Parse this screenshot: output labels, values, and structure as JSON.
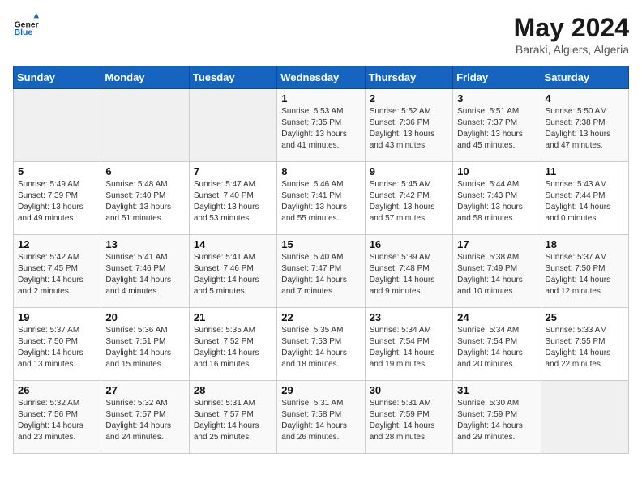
{
  "header": {
    "logo_general": "General",
    "logo_blue": "Blue",
    "title": "May 2024",
    "subtitle": "Baraki, Algiers, Algeria"
  },
  "weekdays": [
    "Sunday",
    "Monday",
    "Tuesday",
    "Wednesday",
    "Thursday",
    "Friday",
    "Saturday"
  ],
  "weeks": [
    [
      {
        "day": "",
        "info": ""
      },
      {
        "day": "",
        "info": ""
      },
      {
        "day": "",
        "info": ""
      },
      {
        "day": "1",
        "info": "Sunrise: 5:53 AM\nSunset: 7:35 PM\nDaylight: 13 hours and 41 minutes."
      },
      {
        "day": "2",
        "info": "Sunrise: 5:52 AM\nSunset: 7:36 PM\nDaylight: 13 hours and 43 minutes."
      },
      {
        "day": "3",
        "info": "Sunrise: 5:51 AM\nSunset: 7:37 PM\nDaylight: 13 hours and 45 minutes."
      },
      {
        "day": "4",
        "info": "Sunrise: 5:50 AM\nSunset: 7:38 PM\nDaylight: 13 hours and 47 minutes."
      }
    ],
    [
      {
        "day": "5",
        "info": "Sunrise: 5:49 AM\nSunset: 7:39 PM\nDaylight: 13 hours and 49 minutes."
      },
      {
        "day": "6",
        "info": "Sunrise: 5:48 AM\nSunset: 7:40 PM\nDaylight: 13 hours and 51 minutes."
      },
      {
        "day": "7",
        "info": "Sunrise: 5:47 AM\nSunset: 7:40 PM\nDaylight: 13 hours and 53 minutes."
      },
      {
        "day": "8",
        "info": "Sunrise: 5:46 AM\nSunset: 7:41 PM\nDaylight: 13 hours and 55 minutes."
      },
      {
        "day": "9",
        "info": "Sunrise: 5:45 AM\nSunset: 7:42 PM\nDaylight: 13 hours and 57 minutes."
      },
      {
        "day": "10",
        "info": "Sunrise: 5:44 AM\nSunset: 7:43 PM\nDaylight: 13 hours and 58 minutes."
      },
      {
        "day": "11",
        "info": "Sunrise: 5:43 AM\nSunset: 7:44 PM\nDaylight: 14 hours and 0 minutes."
      }
    ],
    [
      {
        "day": "12",
        "info": "Sunrise: 5:42 AM\nSunset: 7:45 PM\nDaylight: 14 hours and 2 minutes."
      },
      {
        "day": "13",
        "info": "Sunrise: 5:41 AM\nSunset: 7:46 PM\nDaylight: 14 hours and 4 minutes."
      },
      {
        "day": "14",
        "info": "Sunrise: 5:41 AM\nSunset: 7:46 PM\nDaylight: 14 hours and 5 minutes."
      },
      {
        "day": "15",
        "info": "Sunrise: 5:40 AM\nSunset: 7:47 PM\nDaylight: 14 hours and 7 minutes."
      },
      {
        "day": "16",
        "info": "Sunrise: 5:39 AM\nSunset: 7:48 PM\nDaylight: 14 hours and 9 minutes."
      },
      {
        "day": "17",
        "info": "Sunrise: 5:38 AM\nSunset: 7:49 PM\nDaylight: 14 hours and 10 minutes."
      },
      {
        "day": "18",
        "info": "Sunrise: 5:37 AM\nSunset: 7:50 PM\nDaylight: 14 hours and 12 minutes."
      }
    ],
    [
      {
        "day": "19",
        "info": "Sunrise: 5:37 AM\nSunset: 7:50 PM\nDaylight: 14 hours and 13 minutes."
      },
      {
        "day": "20",
        "info": "Sunrise: 5:36 AM\nSunset: 7:51 PM\nDaylight: 14 hours and 15 minutes."
      },
      {
        "day": "21",
        "info": "Sunrise: 5:35 AM\nSunset: 7:52 PM\nDaylight: 14 hours and 16 minutes."
      },
      {
        "day": "22",
        "info": "Sunrise: 5:35 AM\nSunset: 7:53 PM\nDaylight: 14 hours and 18 minutes."
      },
      {
        "day": "23",
        "info": "Sunrise: 5:34 AM\nSunset: 7:54 PM\nDaylight: 14 hours and 19 minutes."
      },
      {
        "day": "24",
        "info": "Sunrise: 5:34 AM\nSunset: 7:54 PM\nDaylight: 14 hours and 20 minutes."
      },
      {
        "day": "25",
        "info": "Sunrise: 5:33 AM\nSunset: 7:55 PM\nDaylight: 14 hours and 22 minutes."
      }
    ],
    [
      {
        "day": "26",
        "info": "Sunrise: 5:32 AM\nSunset: 7:56 PM\nDaylight: 14 hours and 23 minutes."
      },
      {
        "day": "27",
        "info": "Sunrise: 5:32 AM\nSunset: 7:57 PM\nDaylight: 14 hours and 24 minutes."
      },
      {
        "day": "28",
        "info": "Sunrise: 5:31 AM\nSunset: 7:57 PM\nDaylight: 14 hours and 25 minutes."
      },
      {
        "day": "29",
        "info": "Sunrise: 5:31 AM\nSunset: 7:58 PM\nDaylight: 14 hours and 26 minutes."
      },
      {
        "day": "30",
        "info": "Sunrise: 5:31 AM\nSunset: 7:59 PM\nDaylight: 14 hours and 28 minutes."
      },
      {
        "day": "31",
        "info": "Sunrise: 5:30 AM\nSunset: 7:59 PM\nDaylight: 14 hours and 29 minutes."
      },
      {
        "day": "",
        "info": ""
      }
    ]
  ]
}
